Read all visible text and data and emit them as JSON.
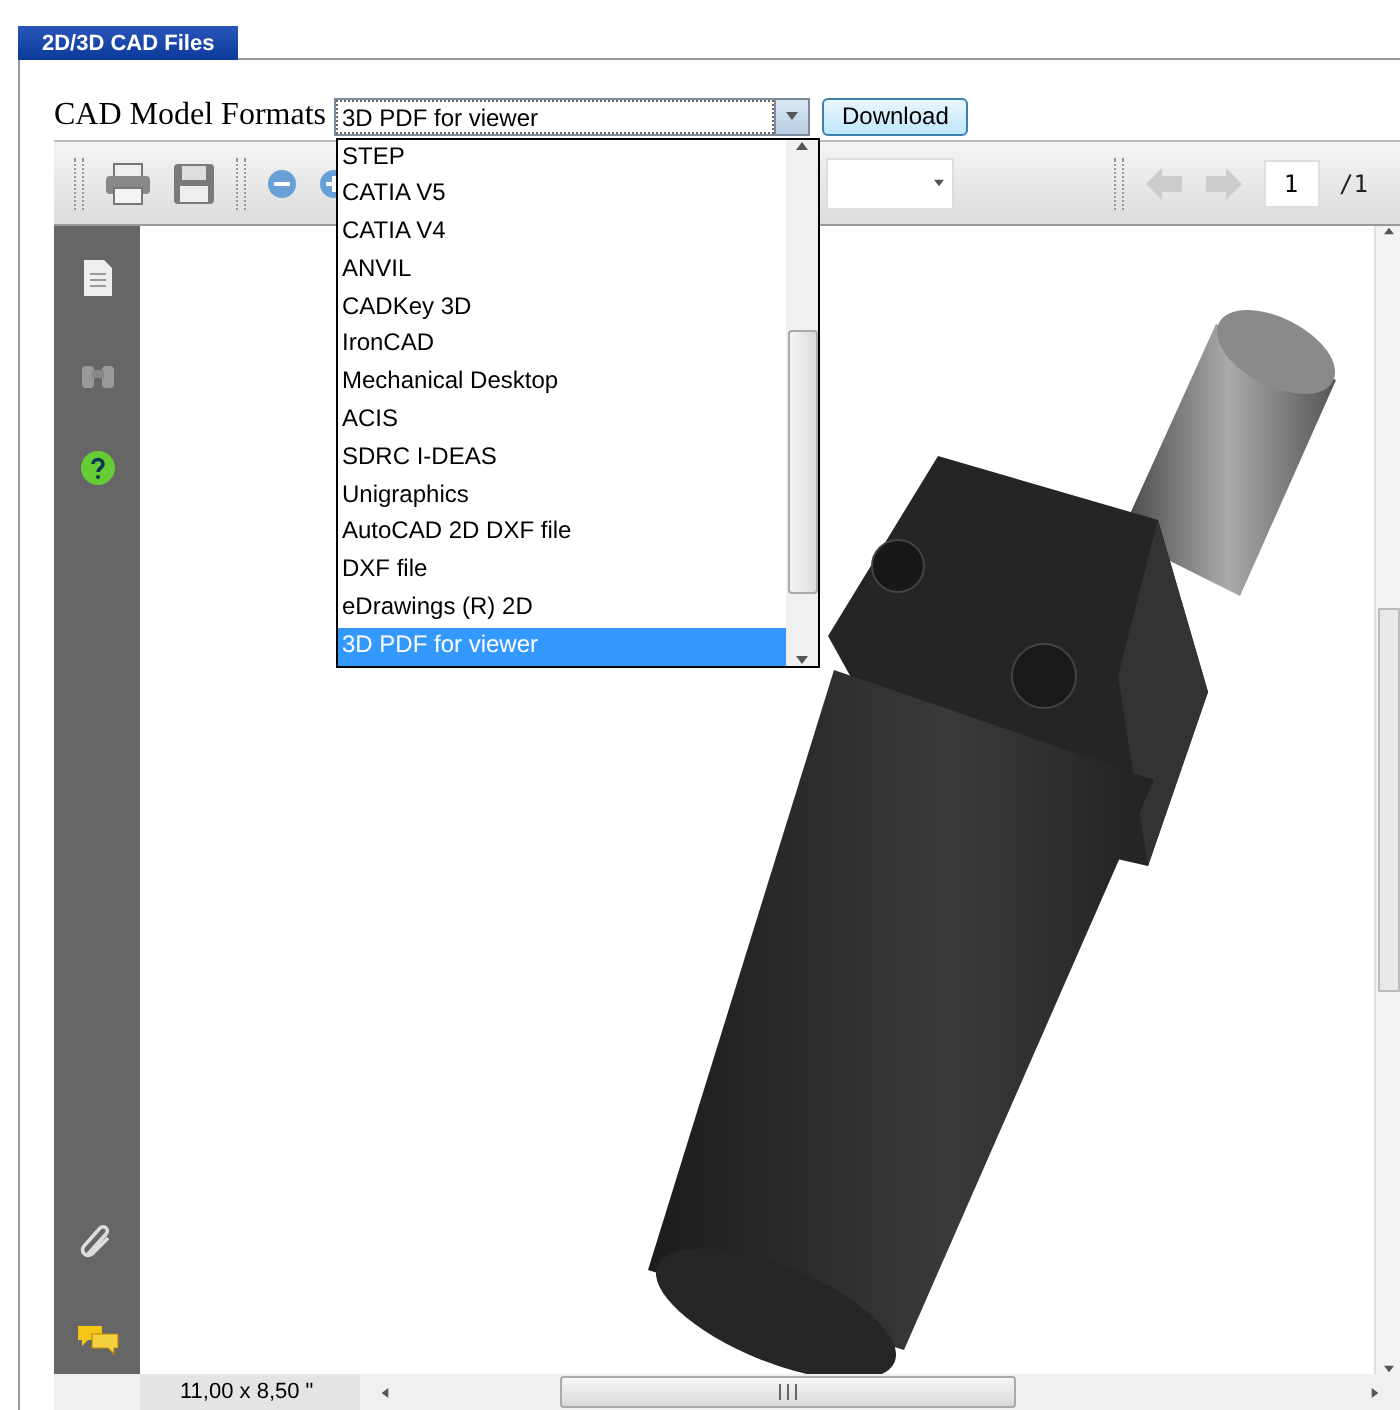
{
  "tab": {
    "label": "2D/3D CAD Files",
    "selected": true
  },
  "format_select": {
    "label": "CAD Model Formats",
    "value": "3D PDF for viewer",
    "expanded": true,
    "options": [
      {
        "label": "STEP",
        "selected": false
      },
      {
        "label": "CATIA V5",
        "selected": false
      },
      {
        "label": "CATIA V4",
        "selected": false
      },
      {
        "label": "ANVIL",
        "selected": false
      },
      {
        "label": "CADKey 3D",
        "selected": false
      },
      {
        "label": "IronCAD",
        "selected": false
      },
      {
        "label": "Mechanical Desktop",
        "selected": false
      },
      {
        "label": "ACIS",
        "selected": false
      },
      {
        "label": "SDRC I-DEAS",
        "selected": false
      },
      {
        "label": "Unigraphics",
        "selected": false
      },
      {
        "label": "AutoCAD 2D DXF file",
        "selected": false
      },
      {
        "label": "DXF file",
        "selected": false
      },
      {
        "label": "eDrawings (R) 2D",
        "selected": false
      },
      {
        "label": "3D PDF for viewer",
        "selected": true
      }
    ]
  },
  "download_button": "Download",
  "viewer": {
    "page_field": "1",
    "page_total": "/1",
    "page_size": "11,00 x 8,50 \""
  }
}
